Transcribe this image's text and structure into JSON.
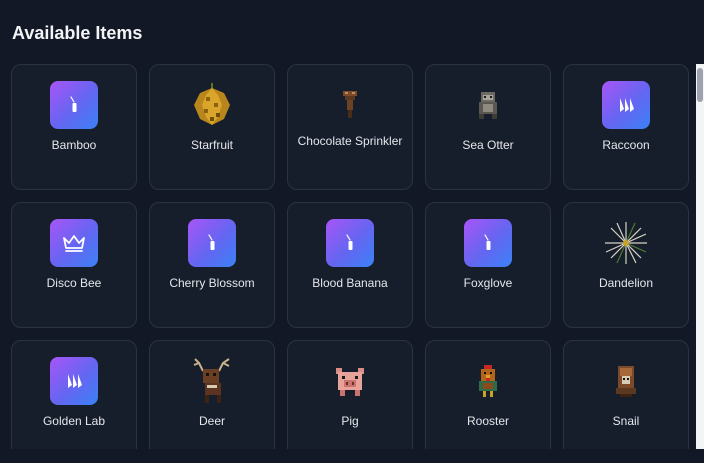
{
  "title": "Available Items",
  "colors": {
    "background": "#121826",
    "card": "#161d2b",
    "card_border": "#2a3343",
    "badge_gradient": [
      "#a855f7",
      "#6366f1",
      "#3b82f6"
    ]
  },
  "items": [
    {
      "label": "Bamboo",
      "icon": "bottle-icon"
    },
    {
      "label": "Starfruit",
      "icon": "starfruit-icon"
    },
    {
      "label": "Chocolate Sprinkler",
      "icon": "chocolate-sprinkler-icon"
    },
    {
      "label": "Sea Otter",
      "icon": "sea-otter-icon"
    },
    {
      "label": "Raccoon",
      "icon": "raccoon-tally-icon"
    },
    {
      "label": "Disco Bee",
      "icon": "crown-icon"
    },
    {
      "label": "Cherry Blossom",
      "icon": "bottle-icon"
    },
    {
      "label": "Blood Banana",
      "icon": "bottle-icon"
    },
    {
      "label": "Foxglove",
      "icon": "bottle-icon"
    },
    {
      "label": "Dandelion",
      "icon": "dandelion-icon"
    },
    {
      "label": "Golden Lab",
      "icon": "golden-lab-tally-icon"
    },
    {
      "label": "Deer",
      "icon": "deer-icon"
    },
    {
      "label": "Pig",
      "icon": "pig-icon"
    },
    {
      "label": "Rooster",
      "icon": "rooster-icon"
    },
    {
      "label": "Snail",
      "icon": "snail-icon"
    }
  ]
}
